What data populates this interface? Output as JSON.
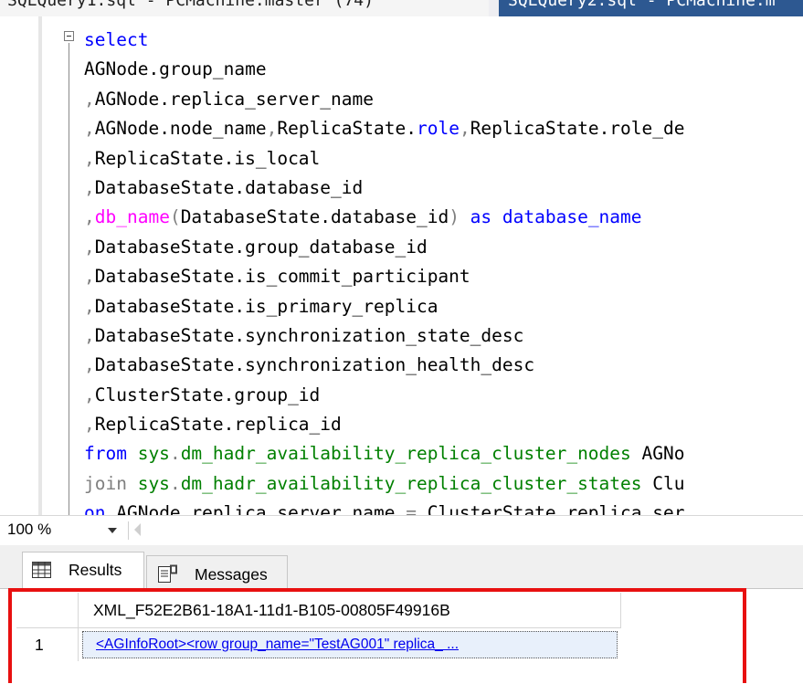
{
  "top_tabs": {
    "active_label": "SQLQuery1.sql - PCMachine.master (74)",
    "inactive_label": "SQLQuery2.sql - PCMachine.m"
  },
  "editor": {
    "lines": [
      [
        {
          "t": "select",
          "c": "kw"
        }
      ],
      [
        {
          "t": "AGNode.group_name",
          "c": ""
        }
      ],
      [
        {
          "t": ",",
          "c": "punc"
        },
        {
          "t": "AGNode.replica_server_name",
          "c": ""
        }
      ],
      [
        {
          "t": ",",
          "c": "punc"
        },
        {
          "t": "AGNode.node_name",
          "c": ""
        },
        {
          "t": ",",
          "c": "punc"
        },
        {
          "t": "ReplicaState.",
          "c": ""
        },
        {
          "t": "role",
          "c": "kw"
        },
        {
          "t": ",",
          "c": "punc"
        },
        {
          "t": "ReplicaState.role_de",
          "c": ""
        }
      ],
      [
        {
          "t": ",",
          "c": "punc"
        },
        {
          "t": "ReplicaState.is_local",
          "c": ""
        }
      ],
      [
        {
          "t": ",",
          "c": "punc"
        },
        {
          "t": "DatabaseState.database_id",
          "c": ""
        }
      ],
      [
        {
          "t": ",",
          "c": "punc"
        },
        {
          "t": "db_name",
          "c": "fn"
        },
        {
          "t": "(",
          "c": "punc"
        },
        {
          "t": "DatabaseState.database_id",
          "c": ""
        },
        {
          "t": ")",
          "c": "punc"
        },
        {
          "t": " as database_name",
          "c": "kw"
        }
      ],
      [
        {
          "t": ",",
          "c": "punc"
        },
        {
          "t": "DatabaseState.group_database_id",
          "c": ""
        }
      ],
      [
        {
          "t": ",",
          "c": "punc"
        },
        {
          "t": "DatabaseState.is_commit_participant",
          "c": ""
        }
      ],
      [
        {
          "t": ",",
          "c": "punc"
        },
        {
          "t": "DatabaseState.is_primary_replica",
          "c": ""
        }
      ],
      [
        {
          "t": ",",
          "c": "punc"
        },
        {
          "t": "DatabaseState.synchronization_state_desc",
          "c": ""
        }
      ],
      [
        {
          "t": ",",
          "c": "punc"
        },
        {
          "t": "DatabaseState.synchronization_health_desc",
          "c": ""
        }
      ],
      [
        {
          "t": ",",
          "c": "punc"
        },
        {
          "t": "ClusterState.group_id",
          "c": ""
        }
      ],
      [
        {
          "t": ",",
          "c": "punc"
        },
        {
          "t": "ReplicaState.replica_id",
          "c": ""
        }
      ],
      [
        {
          "t": "from ",
          "c": "kw"
        },
        {
          "t": "sys",
          "c": "sys"
        },
        {
          "t": ".",
          "c": "punc"
        },
        {
          "t": "dm_hadr_availability_replica_cluster_nodes",
          "c": "sys"
        },
        {
          "t": " AGNo",
          "c": ""
        }
      ],
      [
        {
          "t": "join ",
          "c": "punc"
        },
        {
          "t": "sys",
          "c": "sys"
        },
        {
          "t": ".",
          "c": "punc"
        },
        {
          "t": "dm_hadr_availability_replica_cluster_states",
          "c": "sys"
        },
        {
          "t": " Clu",
          "c": ""
        }
      ],
      [
        {
          "t": "on ",
          "c": "kw"
        },
        {
          "t": "AGNode.replica_server_name ",
          "c": ""
        },
        {
          "t": "=",
          "c": "punc"
        },
        {
          "t": " ClusterState.replica_ser",
          "c": ""
        }
      ]
    ]
  },
  "zoom": {
    "level": "100 %"
  },
  "results_tabs": {
    "results_label": "Results",
    "messages_label": "Messages"
  },
  "grid": {
    "column_header": "XML_F52E2B61-18A1-11d1-B105-00805F49916B",
    "rows": [
      {
        "row_number": "1",
        "xml_value": "<AGInfoRoot><row group_name=\"TestAG001\" replica_ ..."
      }
    ]
  },
  "colors": {
    "keyword": "#0000ff",
    "function": "#ff00ff",
    "system": "#008000",
    "highlight": "#e81010"
  }
}
